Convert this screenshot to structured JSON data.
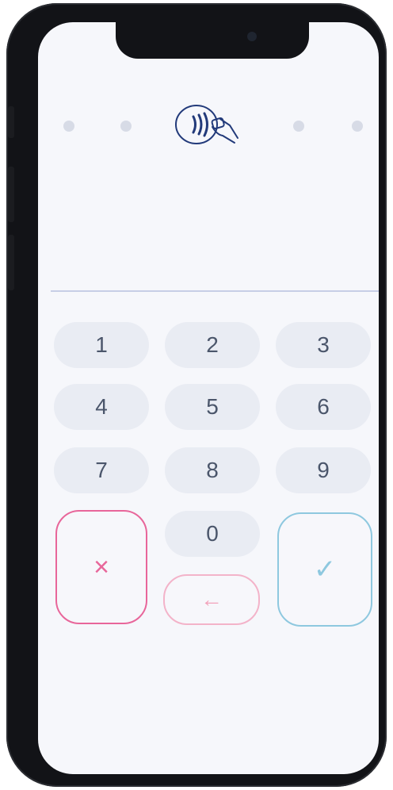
{
  "colors": {
    "phone_body": "#121317",
    "screen_bg": "#f6f7fb",
    "key_bg": "#e9ecf3",
    "key_text": "#4b566b",
    "cancel_accent": "#e8669a",
    "confirm_accent": "#8ec8df",
    "back_accent": "#f3b3c9"
  },
  "status": {
    "contactless_icon": "contactless-icon"
  },
  "keypad": {
    "keys": [
      {
        "label": "1"
      },
      {
        "label": "2"
      },
      {
        "label": "3"
      },
      {
        "label": "4"
      },
      {
        "label": "5"
      },
      {
        "label": "6"
      },
      {
        "label": "7"
      },
      {
        "label": "8"
      },
      {
        "label": "9"
      },
      {
        "label": "0"
      }
    ],
    "cancel": {
      "glyph": "×"
    },
    "confirm": {
      "glyph": "✓"
    },
    "backspace": {
      "glyph": "←"
    }
  }
}
